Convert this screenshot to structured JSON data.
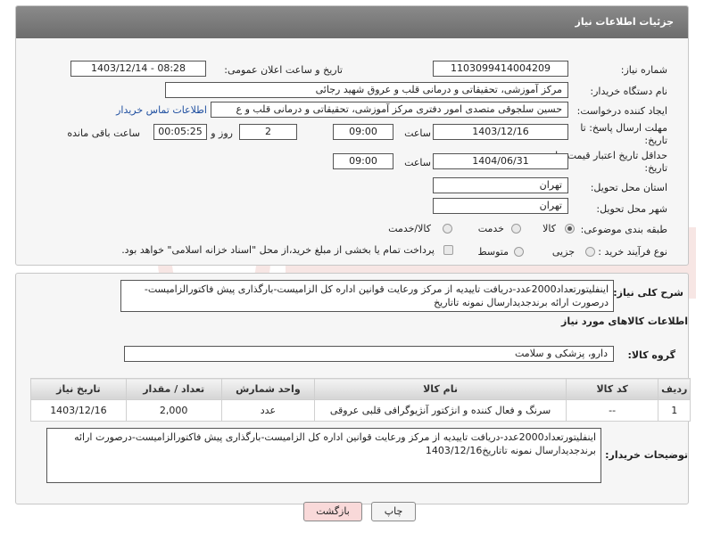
{
  "header": {
    "title": "جزئیات اطلاعات نیاز"
  },
  "fields": {
    "need_number_label": "شماره نیاز:",
    "need_number": "1103099414004209",
    "announce_label": "تاریخ و ساعت اعلان عمومی:",
    "announce_value": "1403/12/14 - 08:28",
    "buyer_label": "نام دستگاه خریدار:",
    "buyer_value": "مرکز آموزشی، تحقیقاتی و درمانی قلب و عروق شهید رجائی",
    "creator_label": "ایجاد کننده درخواست:",
    "creator_value": "حسین سلجوقی متصدی امور دفتری مرکز آموزشی، تحقیقاتی و درمانی قلب و ع",
    "contact_link": "اطلاعات تماس خریدار",
    "reply_deadline_label": "مهلت ارسال پاسخ: تا",
    "reply_deadline_label2": "تاریخ:",
    "reply_date": "1403/12/16",
    "time_label": "ساعت",
    "reply_time": "09:00",
    "days_value": "2",
    "days_label": "روز و",
    "remaining_value": "00:05:25",
    "remaining_label": "ساعت باقی مانده",
    "price_validity_label": "حداقل تاریخ اعتبار قیمت: تا",
    "price_validity_label2": "تاریخ:",
    "price_date": "1404/06/31",
    "price_time": "09:00",
    "province_label": "استان محل تحویل:",
    "province_value": "تهران",
    "city_label": "شهر محل تحویل:",
    "city_value": "تهران",
    "category_label": "طبقه بندی موضوعی:",
    "category_options": [
      "کالا",
      "خدمت",
      "کالا/خدمت"
    ],
    "purchase_label": "نوع فرآیند خرید :",
    "purchase_options": [
      "جزیی",
      "متوسط"
    ],
    "payment_note": "پرداخت تمام یا بخشی از مبلغ خرید،از محل \"اسناد خزانه اسلامی\" خواهد بود."
  },
  "summary": {
    "label": "شرح کلی نیاز:",
    "text": "اینفلیتورتعداد2000عدد-دریافت تاییدیه از مرکز ورعایت قوانین اداره کل الزامیست-بارگذاری پیش فاکتورالزامیست-درصورت ارائه برندجدیدارسال نمونه تاتاریخ"
  },
  "goods_info": {
    "title": "اطلاعات کالاهای مورد نیاز",
    "group_label": "گروه کالا:",
    "group_value": "دارو، پزشکی و سلامت"
  },
  "table": {
    "headers": [
      "ردیف",
      "کد کالا",
      "نام کالا",
      "واحد شمارش",
      "تعداد / مقدار",
      "تاریخ نیاز"
    ],
    "rows": [
      [
        "1",
        "--",
        "سرنگ و فعال کننده و انژکتور آنژیوگرافی قلبی عروقی",
        "عدد",
        "2,000",
        "1403/12/16"
      ]
    ]
  },
  "buyer_notes": {
    "label": "توضیحات خریدار:",
    "text": "اینفلیتورتعداد2000عدد-دریافت تاییدیه از مرکز ورعایت قوانین اداره کل الزامیست-بارگذاری پیش فاکتورالزامیست-درصورت ارائه برندجدیدارسال نمونه تاتاریخ1403/12/16"
  },
  "buttons": {
    "print": "چاپ",
    "back": "بازگشت"
  },
  "colors": {
    "header_bg": "#7a7a7a",
    "link": "#1f4fa0",
    "back_btn_bg": "#f9d9d9"
  }
}
